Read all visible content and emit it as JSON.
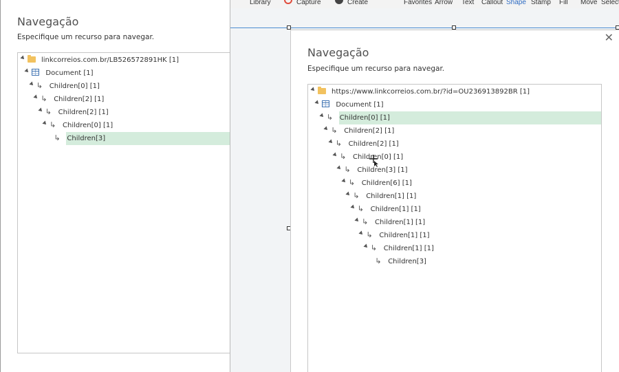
{
  "back_dialog": {
    "title": "Navegação",
    "subtitle": "Especifique um recurso para navegar.",
    "tree": [
      {
        "label": "linkcorreios.com.br/LB526572891HK [1]",
        "icon": "folder-icon",
        "depth": 0,
        "expanded": true,
        "selected": false
      },
      {
        "label": "Document [1]",
        "icon": "table-icon",
        "depth": 1,
        "expanded": true,
        "selected": false
      },
      {
        "label": "Children[0] [1]",
        "icon": "child-arrow-icon",
        "depth": 2,
        "expanded": true,
        "selected": false
      },
      {
        "label": "Children[2] [1]",
        "icon": "child-arrow-icon",
        "depth": 3,
        "expanded": true,
        "selected": false
      },
      {
        "label": "Children[2] [1]",
        "icon": "child-arrow-icon",
        "depth": 4,
        "expanded": true,
        "selected": false
      },
      {
        "label": "Children[0] [1]",
        "icon": "child-arrow-icon",
        "depth": 5,
        "expanded": true,
        "selected": false
      },
      {
        "label": "Children[3]",
        "icon": "child-arrow-icon",
        "depth": 6,
        "expanded": false,
        "selected": true
      }
    ]
  },
  "toolbar": {
    "library": "Library",
    "capture": "Capture",
    "create": "Create",
    "favorites": "Favorites",
    "arrow": "Arrow",
    "text": "Text",
    "callout": "Callout",
    "shape": "Shape",
    "stamp": "Stamp",
    "fill": "Fill",
    "move": "Move",
    "select": "Select",
    "active_tool": "Shape",
    "active_color": "#2d6bc3"
  },
  "front_dialog": {
    "title": "Navegação",
    "subtitle": "Especifique um recurso para navegar.",
    "close_icon": "close-icon",
    "tree": [
      {
        "label": "https://www.linkcorreios.com.br/?id=OU236913892BR [1]",
        "icon": "folder-icon",
        "depth": 0,
        "expanded": true,
        "selected": false
      },
      {
        "label": "Document [1]",
        "icon": "table-icon",
        "depth": 1,
        "expanded": true,
        "selected": false
      },
      {
        "label": "Children[0] [1]",
        "icon": "child-arrow-icon",
        "depth": 2,
        "expanded": true,
        "selected": true
      },
      {
        "label": "Children[2] [1]",
        "icon": "child-arrow-icon",
        "depth": 3,
        "expanded": true,
        "selected": false
      },
      {
        "label": "Children[2] [1]",
        "icon": "child-arrow-icon",
        "depth": 4,
        "expanded": true,
        "selected": false
      },
      {
        "label": "Children[0] [1]",
        "icon": "child-arrow-icon",
        "depth": 5,
        "expanded": true,
        "selected": false
      },
      {
        "label": "Children[3] [1]",
        "icon": "child-arrow-icon",
        "depth": 6,
        "expanded": true,
        "selected": false
      },
      {
        "label": "Children[6] [1]",
        "icon": "child-arrow-icon",
        "depth": 7,
        "expanded": true,
        "selected": false
      },
      {
        "label": "Children[1] [1]",
        "icon": "child-arrow-icon",
        "depth": 8,
        "expanded": true,
        "selected": false
      },
      {
        "label": "Children[1] [1]",
        "icon": "child-arrow-icon",
        "depth": 9,
        "expanded": true,
        "selected": false
      },
      {
        "label": "Children[1] [1]",
        "icon": "child-arrow-icon",
        "depth": 10,
        "expanded": true,
        "selected": false
      },
      {
        "label": "Children[1] [1]",
        "icon": "child-arrow-icon",
        "depth": 11,
        "expanded": true,
        "selected": false
      },
      {
        "label": "Children[1] [1]",
        "icon": "child-arrow-icon",
        "depth": 12,
        "expanded": true,
        "selected": false
      },
      {
        "label": "Children[3]",
        "icon": "child-arrow-icon",
        "depth": 13,
        "expanded": false,
        "selected": false
      }
    ]
  },
  "colors": {
    "selection": "#d4ecdc",
    "folder": "#f2c25f",
    "table": "#3a6fb0",
    "accent_line": "#4a8bd0"
  }
}
